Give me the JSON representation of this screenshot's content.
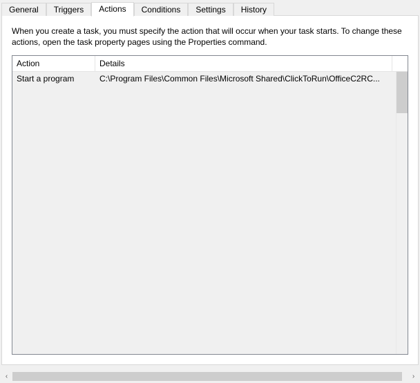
{
  "tabs": {
    "general": "General",
    "triggers": "Triggers",
    "actions": "Actions",
    "conditions": "Conditions",
    "settings": "Settings",
    "history": "History"
  },
  "description": "When you create a task, you must specify the action that will occur when your task starts.  To change these actions, open the task property pages using the Properties command.",
  "columns": {
    "action": "Action",
    "details": "Details"
  },
  "rows": [
    {
      "action": "Start a program",
      "details": "C:\\Program Files\\Common Files\\Microsoft Shared\\ClickToRun\\OfficeC2RC..."
    }
  ],
  "scroll": {
    "left_glyph": "‹",
    "right_glyph": "›"
  }
}
